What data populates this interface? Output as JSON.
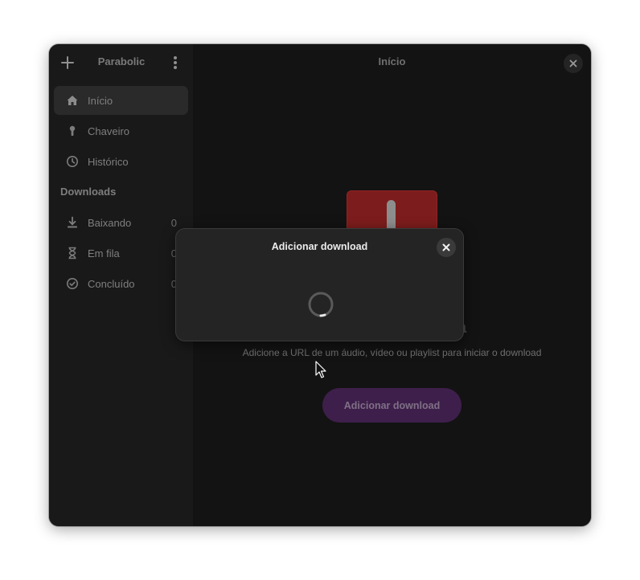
{
  "sidebar": {
    "title": "Parabolic",
    "items": [
      {
        "label": "Início",
        "icon": "home-icon"
      },
      {
        "label": "Chaveiro",
        "icon": "keyring-icon"
      },
      {
        "label": "Histórico",
        "icon": "history-icon"
      }
    ],
    "section_label": "Downloads",
    "downloads": [
      {
        "label": "Baixando",
        "count": "0",
        "icon": "download-icon"
      },
      {
        "label": "Em fila",
        "count": "0",
        "icon": "hourglass-icon"
      },
      {
        "label": "Concluído",
        "count": "0",
        "icon": "check-circle-icon"
      }
    ]
  },
  "main": {
    "title": "Início",
    "status_title_tail": "a",
    "description": "Adicione a URL de um áudio, vídeo ou playlist para iniciar o download",
    "add_button_label": "Adicionar download"
  },
  "dialog": {
    "title": "Adicionar download"
  },
  "colors": {
    "accent": "#3e1f4b",
    "illustration": "#7d1c1c"
  }
}
